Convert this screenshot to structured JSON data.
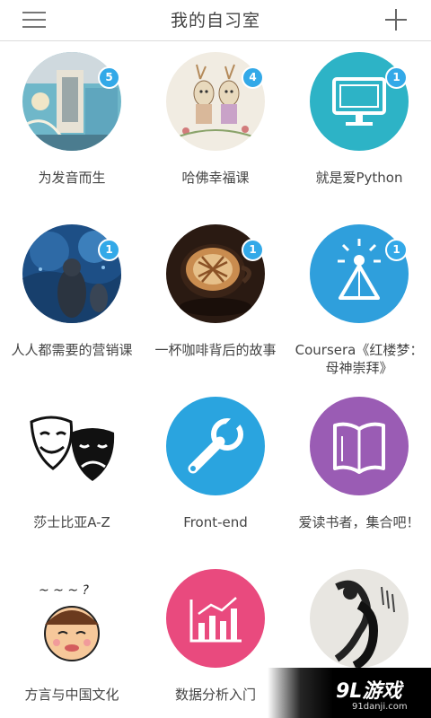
{
  "header": {
    "title": "我的自习室",
    "menu_icon": "hamburger-menu-icon",
    "add_icon": "plus-icon"
  },
  "rooms": [
    {
      "name": "为发音而生",
      "badge": "5",
      "image": "street-mural-photo"
    },
    {
      "name": "哈佛幸福课",
      "badge": "4",
      "image": "illustrated-deer-drawing"
    },
    {
      "name": "就是爱Python",
      "badge": "1",
      "image": "monitor-icon",
      "color": "#2db3c6"
    },
    {
      "name": "人人都需要的营销课",
      "badge": "1",
      "image": "aquarium-photo"
    },
    {
      "name": "一杯咖啡背后的故事",
      "badge": "1",
      "image": "latte-art-photo"
    },
    {
      "name": "Coursera《红楼梦：母神崇拜》",
      "badge": "1",
      "image": "glowing-pyramid-icon",
      "color": "#2f9fdc"
    },
    {
      "name": "莎士比亚A-Z",
      "badge": "",
      "image": "theater-masks-drawing"
    },
    {
      "name": "Front-end",
      "badge": "",
      "image": "wrench-icon",
      "color": "#2aa4df"
    },
    {
      "name": "爱读书者，集合吧！",
      "badge": "",
      "image": "open-book-icon",
      "color": "#9a5cb4"
    },
    {
      "name": "方言与中国文化",
      "badge": "",
      "image": "cartoon-girl-drawing"
    },
    {
      "name": "数据分析入门",
      "badge": "",
      "image": "bar-chart-icon",
      "color": "#e94a7e"
    },
    {
      "name": "",
      "badge": "",
      "image": "ink-figure-painting"
    }
  ],
  "watermark": {
    "main": "9L游戏",
    "sub": "91danji.com"
  },
  "colors": {
    "badge": "#33a9e8",
    "teal": "#2db3c6",
    "blue": "#2f9fdc",
    "purple": "#9a5cb4",
    "pink": "#e94a7e"
  }
}
